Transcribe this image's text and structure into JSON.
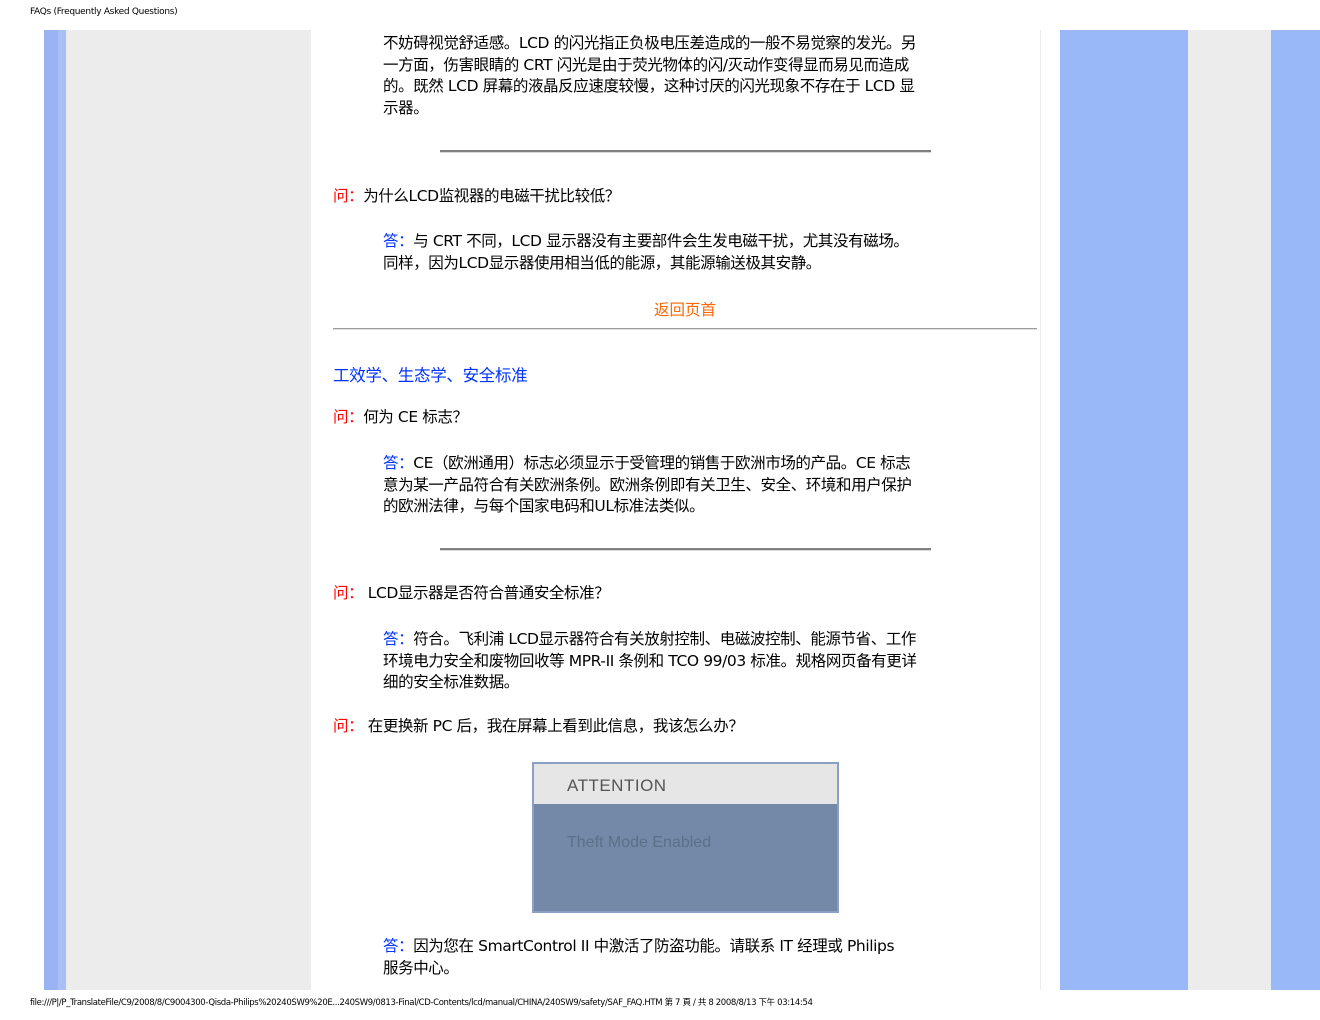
{
  "page": {
    "header": "FAQs (Frequently Asked Questions)",
    "footer": "file:///P|/P_TranslateFile/C9/2008/8/C9004300-Qisda-Philips%20240SW9%20E...240SW9/0813-Final/CD-Contents/lcd/manual/CHINA/240SW9/safety/SAF_FAQ.HTM 第 7 頁 / 共 8 2008/8/13 下午 03:14:54"
  },
  "content": {
    "intro_lines": [
      "不妨碍视觉舒适感。LCD 的闪光指正负极电压差造成的一般不易觉察的发光。另",
      "一方面，伤害眼睛的 CRT 闪光是由于荧光物体的闪/灭动作变得显而易见而造成",
      "的。既然 LCD 屏幕的液晶反应速度较慢，这种讨厌的闪光现象不存在于 LCD 显",
      "示器。"
    ],
    "q_label": "问：",
    "a_label": "答：",
    "q1_text": "为什么LCD监视器的电磁干扰比较低？",
    "a1_lines": [
      "与 CRT 不同，LCD 显示器没有主要部件会生发电磁干扰，尤其没有磁场。",
      "同样，因为LCD显示器使用相当低的能源，其能源输送极其安静。"
    ],
    "back_to_top": "返回页首",
    "section_title": "工效学、生态学、安全标准",
    "q2_text": "何为 CE 标志？",
    "a2_lines": [
      "CE（欧洲通用）标志必须显示于受管理的销售于欧洲市场的产品。CE 标志",
      "意为某一产品符合有关欧洲条例。欧洲条例即有关卫生、安全、环境和用户保护",
      "的欧洲法律，与每个国家电码和UL标准法类似。"
    ],
    "q3_text": "LCD显示器是否符合普通安全标准？",
    "a3_lines": [
      "符合。飞利浦 LCD显示器符合有关放射控制、电磁波控制、能源节省、工作",
      "环境电力安全和废物回收等 MPR-II 条例和 TCO 99/03 标准。规格网页备有更详",
      "细的安全标准数据。"
    ],
    "q4_text": "在更换新 PC 后，我在屏幕上看到此信息，我该怎么办？",
    "dialog": {
      "title": "ATTENTION",
      "message": "Theft Mode Enabled"
    },
    "a4_lines": [
      "因为您在 SmartControl II 中激活了防盗功能。请联系 IT 经理或 Philips",
      "服务中心。"
    ]
  }
}
